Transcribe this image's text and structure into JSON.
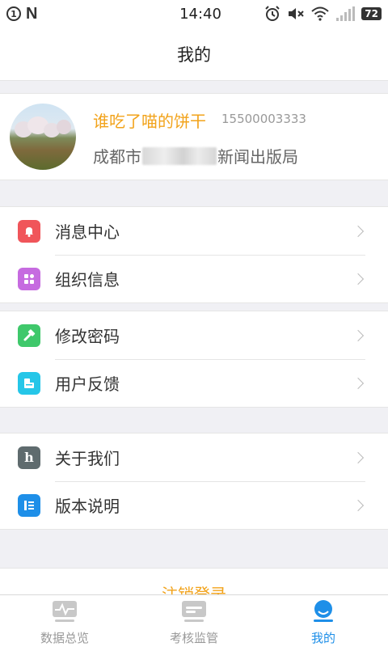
{
  "status_bar": {
    "notification_count": "1",
    "time": "14:40",
    "battery": "72"
  },
  "header": {
    "title": "我的"
  },
  "profile": {
    "name": "谁吃了喵的饼干",
    "phone": "15500003333",
    "org_prefix": "成都市",
    "org_suffix": "新闻出版局"
  },
  "menu_groups": [
    {
      "items": [
        {
          "label": "消息中心",
          "icon": "bell-icon",
          "color": "#f0555a"
        },
        {
          "label": "组织信息",
          "icon": "grid-icon",
          "color": "#c66be0"
        }
      ]
    },
    {
      "items": [
        {
          "label": "修改密码",
          "icon": "hammer-icon",
          "color": "#3fc86b"
        },
        {
          "label": "用户反馈",
          "icon": "feedback-icon",
          "color": "#25c6e8"
        }
      ]
    },
    {
      "items": [
        {
          "label": "关于我们",
          "icon": "h-letter-icon",
          "color": "#5f6b6e"
        },
        {
          "label": "版本说明",
          "icon": "list-icon",
          "color": "#1e8fe8"
        }
      ]
    }
  ],
  "logout": {
    "label": "注销登录"
  },
  "tabs": [
    {
      "label": "数据总览",
      "icon": "pulse-chart-icon",
      "active": false
    },
    {
      "label": "考核监管",
      "icon": "card-icon",
      "active": false
    },
    {
      "label": "我的",
      "icon": "user-icon",
      "active": true
    }
  ],
  "colors": {
    "accent": "#f2a31b",
    "tab_active": "#1e8fe8"
  }
}
